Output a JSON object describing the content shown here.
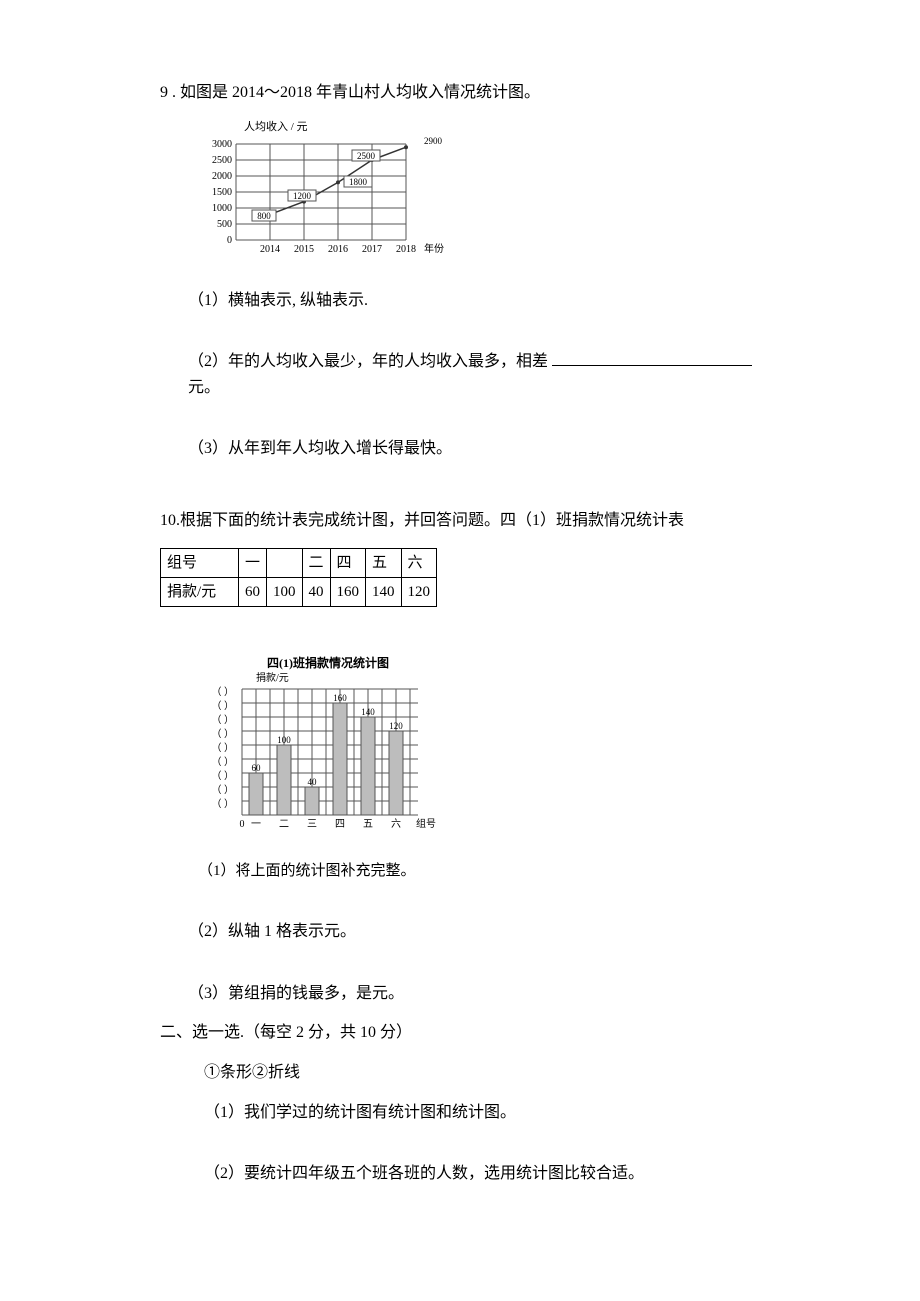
{
  "q9": {
    "title": "9 . 如图是 2014～2018 年青山村人均收入情况统计图。",
    "chart": {
      "type": "line",
      "y_title": "人均收入 / 元",
      "y_ticks": [
        "0",
        "500",
        "1000",
        "1500",
        "2000",
        "2500",
        "3000"
      ],
      "x_title": "年份",
      "x_ticks": [
        "2014",
        "2015",
        "2016",
        "2017",
        "2018"
      ],
      "data_labels": [
        "800",
        "1200",
        "1800",
        "2500",
        "2900"
      ]
    },
    "sub1": "（1）横轴表示, 纵轴表示.",
    "sub2_pre": "（2）年的人均收入最少，年的人均收入最多，相差",
    "sub2_post": "元。",
    "sub3": "（3）从年到年人均收入增长得最快。"
  },
  "q10": {
    "title": "10.根据下面的统计表完成统计图，并回答问题。四（1）班捐款情况统计表",
    "table": {
      "row1": [
        "组号",
        "一",
        "",
        "二",
        "四",
        "五",
        "六"
      ],
      "row2": [
        "捐款/元",
        "60",
        "100",
        "40",
        "160",
        "140",
        "120"
      ]
    },
    "chart": {
      "type": "bar",
      "title": "四(1)班捐款情况统计图",
      "y_title": "捐款/元",
      "x_title": "组号",
      "x_ticks": [
        "一",
        "二",
        "三",
        "四",
        "五",
        "六"
      ],
      "bar_labels": [
        "60",
        "100",
        "40",
        "160",
        "140",
        "120"
      ],
      "y_blanks_left": "（ ）"
    },
    "sub1": "（1）将上面的统计图补充完整。",
    "sub2": "（2）纵轴 1 格表示元。",
    "sub3": "（3）第组捐的钱最多，是元。"
  },
  "section2": {
    "head": "二、选一选.（每空 2 分，共 10 分）",
    "options": "①条形②折线",
    "sub1": "（1）我们学过的统计图有统计图和统计图。",
    "sub2": "（2）要统计四年级五个班各班的人数，选用统计图比较合适。"
  },
  "chart_data": [
    {
      "type": "line",
      "title": "2014～2018 年青山村人均收入情况统计图",
      "xlabel": "年份",
      "ylabel": "人均收入 / 元",
      "x": [
        2014,
        2015,
        2016,
        2017,
        2018
      ],
      "values": [
        800,
        1200,
        1800,
        2500,
        2900
      ],
      "ylim": [
        0,
        3000
      ],
      "y_ticks": [
        0,
        500,
        1000,
        1500,
        2000,
        2500,
        3000
      ]
    },
    {
      "type": "bar",
      "title": "四(1)班捐款情况统计图",
      "xlabel": "组号",
      "ylabel": "捐款/元",
      "categories": [
        "一",
        "二",
        "三",
        "四",
        "五",
        "六"
      ],
      "values": [
        60,
        100,
        40,
        160,
        140,
        120
      ],
      "ylim": [
        0,
        180
      ]
    }
  ]
}
